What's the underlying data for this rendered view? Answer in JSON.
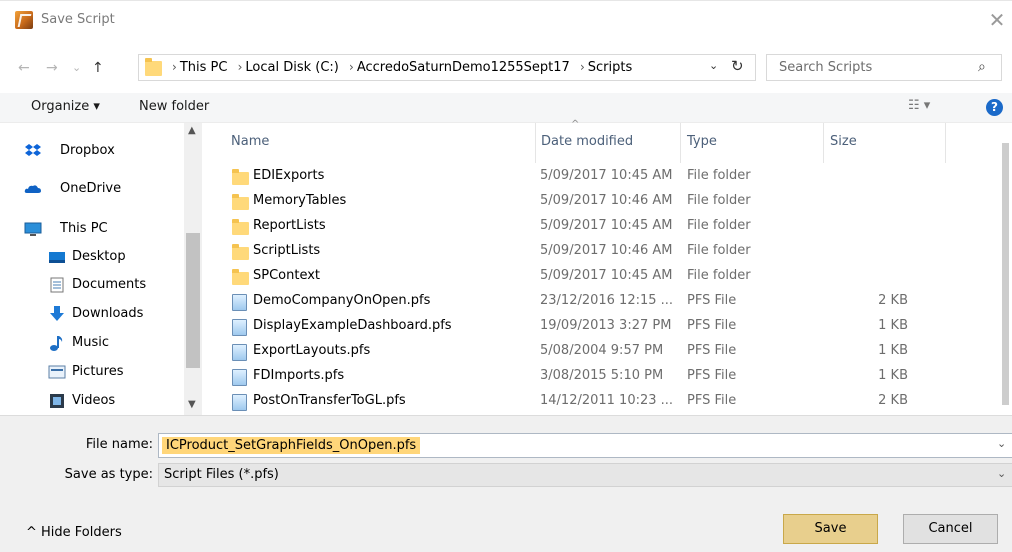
{
  "window": {
    "title": "Save Script",
    "close_glyph": "✕"
  },
  "nav": {
    "back": "←",
    "forward": "→",
    "recent": "⌄",
    "up": "↑"
  },
  "address": {
    "crumbs": [
      "This PC",
      "Local Disk (C:)",
      "AccredoSaturnDemo1255Sept17",
      "Scripts"
    ],
    "separator": "›",
    "dropdown": "⌄",
    "refresh": "↻"
  },
  "search": {
    "placeholder": "Search Scripts",
    "icon": "⌕"
  },
  "toolbar": {
    "organize": "Organize ▾",
    "new_folder": "New folder",
    "view_glyph": "☷ ▾",
    "help": "?"
  },
  "sidebar": {
    "items": [
      {
        "label": "Dropbox",
        "icon": "dropbox-icon"
      },
      {
        "label": "OneDrive",
        "icon": "cloud-icon"
      },
      {
        "label": "This PC",
        "icon": "computer-icon"
      },
      {
        "label": "Desktop",
        "icon": "desktop-icon"
      },
      {
        "label": "Documents",
        "icon": "documents-icon"
      },
      {
        "label": "Downloads",
        "icon": "download-icon"
      },
      {
        "label": "Music",
        "icon": "music-icon"
      },
      {
        "label": "Pictures",
        "icon": "pictures-icon"
      },
      {
        "label": "Videos",
        "icon": "videos-icon"
      }
    ]
  },
  "columns": {
    "name": "Name",
    "date": "Date modified",
    "type": "Type",
    "size": "Size"
  },
  "files": [
    {
      "name": "EDIExports",
      "date": "5/09/2017 10:45 AM",
      "type": "File folder",
      "size": "",
      "kind": "folder"
    },
    {
      "name": "MemoryTables",
      "date": "5/09/2017 10:46 AM",
      "type": "File folder",
      "size": "",
      "kind": "folder"
    },
    {
      "name": "ReportLists",
      "date": "5/09/2017 10:45 AM",
      "type": "File folder",
      "size": "",
      "kind": "folder"
    },
    {
      "name": "ScriptLists",
      "date": "5/09/2017 10:46 AM",
      "type": "File folder",
      "size": "",
      "kind": "folder"
    },
    {
      "name": "SPContext",
      "date": "5/09/2017 10:45 AM",
      "type": "File folder",
      "size": "",
      "kind": "folder"
    },
    {
      "name": "DemoCompanyOnOpen.pfs",
      "date": "23/12/2016 12:15 ...",
      "type": "PFS File",
      "size": "2 KB",
      "kind": "file"
    },
    {
      "name": "DisplayExampleDashboard.pfs",
      "date": "19/09/2013 3:27 PM",
      "type": "PFS File",
      "size": "1 KB",
      "kind": "file"
    },
    {
      "name": "ExportLayouts.pfs",
      "date": "5/08/2004 9:57 PM",
      "type": "PFS File",
      "size": "1 KB",
      "kind": "file"
    },
    {
      "name": "FDImports.pfs",
      "date": "3/08/2015 5:10 PM",
      "type": "PFS File",
      "size": "1 KB",
      "kind": "file"
    },
    {
      "name": "PostOnTransferToGL.pfs",
      "date": "14/12/2011 10:23 ...",
      "type": "PFS File",
      "size": "2 KB",
      "kind": "file"
    }
  ],
  "form": {
    "file_name_label": "File name:",
    "file_name_value": "ICProduct_SetGraphFields_OnOpen.pfs",
    "save_type_label": "Save as type:",
    "save_type_value": "Script Files (*.pfs)",
    "dropdown": "⌄"
  },
  "footer": {
    "hide_folders": "^  Hide Folders",
    "save": "Save",
    "cancel": "Cancel"
  },
  "colors": {
    "accent": "#1b6ac9",
    "selection": "#ffd67a",
    "save_button": "#e8cf8d",
    "folder": "#ffd97a"
  }
}
